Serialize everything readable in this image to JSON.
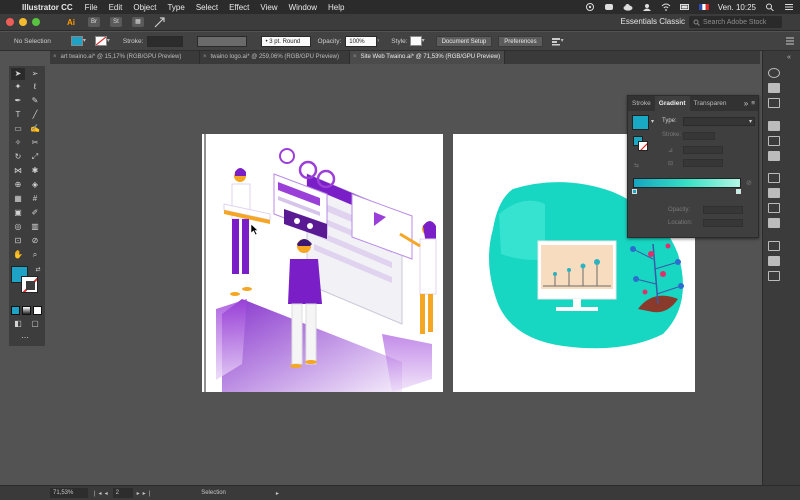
{
  "menubar": {
    "app_name": "Illustrator CC",
    "items": [
      "File",
      "Edit",
      "Object",
      "Type",
      "Select",
      "Effect",
      "View",
      "Window",
      "Help"
    ],
    "clock": "Ven. 10:25"
  },
  "appbar": {
    "logo": "Ai",
    "workspace": "Essentials Classic",
    "search_placeholder": "Search Adobe Stock"
  },
  "controlbar": {
    "selection_label": "No Selection",
    "stroke_label": "Stroke:",
    "stroke_profile": "3 pt. Round",
    "opacity_label": "Opacity:",
    "opacity_value": "100%",
    "style_label": "Style:",
    "document_setup": "Document Setup",
    "preferences": "Preferences",
    "fill_color": "#1ea3c7"
  },
  "tabs": [
    {
      "label": "art twaino.ai* @ 15,17% (RGB/GPU Preview)",
      "active": false
    },
    {
      "label": "twaino logo.ai* @ 259,06% (RGB/GPU Preview)",
      "active": false
    },
    {
      "label": "Site Web Twaino.ai* @ 71,53% (RGB/GPU Preview)",
      "active": true
    }
  ],
  "gradient_panel": {
    "tabs": [
      "Stroke",
      "Gradient",
      "Transparen"
    ],
    "type_label": "Type:",
    "stroke_label": "Stroke:",
    "opacity_label": "Opacity:",
    "location_label": "Location:",
    "ramp_colors": [
      "#15a6c2",
      "#37e0c4",
      "#b2f7e5"
    ]
  },
  "statusbar": {
    "zoom": "71,53%",
    "page": "2",
    "mode": "Selection"
  }
}
